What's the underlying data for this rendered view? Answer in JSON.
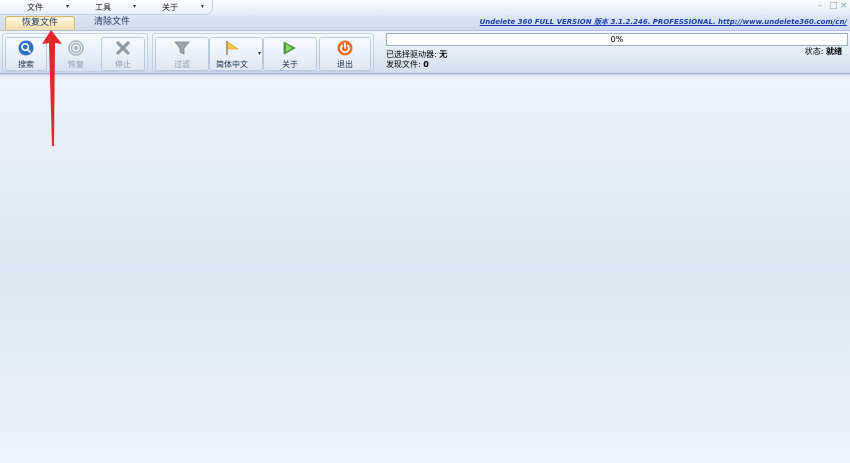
{
  "menu": {
    "items": [
      {
        "label": "文件",
        "caret": "▾"
      },
      {
        "label": "工具",
        "caret": "▾"
      },
      {
        "label": "关于",
        "caret": "▾"
      }
    ]
  },
  "window_controls": {
    "minimize": "–",
    "restore": "□",
    "close": "×"
  },
  "tabs": [
    {
      "label": "恢复文件",
      "active": true
    },
    {
      "label": "清除文件",
      "active": false
    }
  ],
  "version_link": "Undelete 360 FULL VERSION 版本 3.1.2.246. PROFESSIONAL. http://www.undelete360.com/cn/",
  "toolbar": {
    "search_label": "搜索",
    "recover_label": "恢复",
    "stop_label": "停止",
    "filter_label": "过滤",
    "language_label": "简体中文",
    "language_caret": "▾",
    "about_label": "关于",
    "exit_label": "退出"
  },
  "icons": {
    "search": "search-icon",
    "recover": "recover-icon",
    "stop": "stop-icon",
    "filter": "filter-icon",
    "language": "language-flag-icon",
    "about": "about-icon",
    "exit": "exit-icon"
  },
  "progress": {
    "value": 0,
    "text": "0%"
  },
  "info": {
    "selected_drive_label": "已选择驱动器:",
    "selected_drive_value": "无",
    "found_files_label": "发现文件:",
    "found_files_value": "0"
  },
  "status": {
    "label": "状态:",
    "value": "就绪"
  },
  "colors": {
    "accent": "#1c3fb0",
    "arrow": "#e3262b",
    "exit": "#e8702a"
  }
}
